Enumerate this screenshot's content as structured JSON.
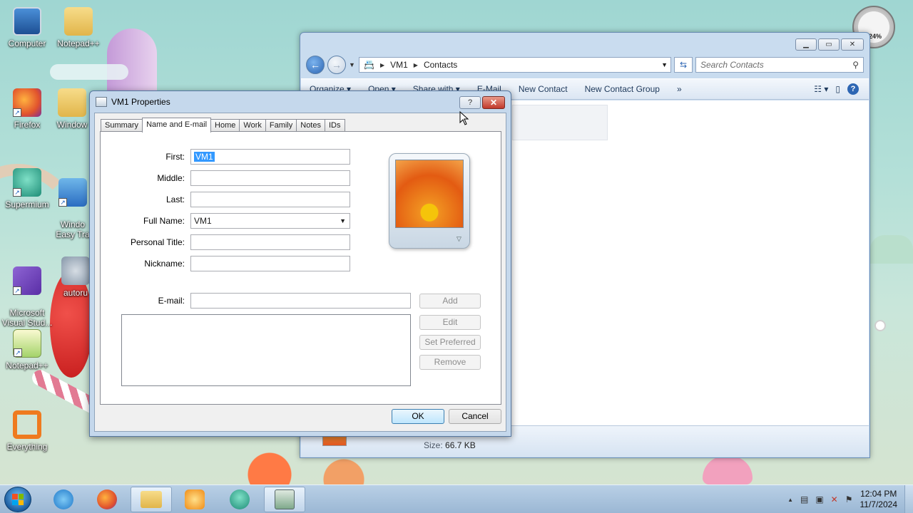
{
  "desktop": {
    "icons": [
      {
        "label": "Computer",
        "icon": "computer-icon"
      },
      {
        "label": "Notepad++",
        "icon": "folder-icon"
      },
      {
        "label": "Firefox",
        "icon": "firefox-icon"
      },
      {
        "label": "Window",
        "icon": "folder-icon"
      },
      {
        "label": "Supermium",
        "icon": "supermium-icon"
      },
      {
        "label": "Windo\nEasy Tra",
        "icon": "easy-transfer-icon"
      },
      {
        "label": "Microsoft\nVisual Stud...",
        "icon": "visual-studio-icon"
      },
      {
        "label": "autoru",
        "icon": "autorun-icon"
      },
      {
        "label": "Notepad++",
        "icon": "notepad-plus-plus-icon"
      },
      {
        "label": "Everything",
        "icon": "everything-icon"
      }
    ],
    "gauge_label": "24%"
  },
  "explorer": {
    "breadcrumb": [
      "VM1",
      "Contacts"
    ],
    "search_placeholder": "Search Contacts",
    "commands": [
      "Organize ▾",
      "Open ▾",
      "Share with ▾",
      "E-Mail",
      "New Contact",
      "New Contact Group",
      "»"
    ],
    "details": {
      "size_label": "Size:",
      "size_value": "66.7 KB"
    }
  },
  "dialog": {
    "title": "VM1 Properties",
    "help_glyph": "?",
    "close_glyph": "✕",
    "tabs": [
      "Summary",
      "Name and E-mail",
      "Home",
      "Work",
      "Family",
      "Notes",
      "IDs"
    ],
    "active_tab": "Name and E-mail",
    "fields": {
      "first_label": "First:",
      "first_value": "VM1",
      "middle_label": "Middle:",
      "middle_value": "",
      "last_label": "Last:",
      "last_value": "",
      "full_name_label": "Full Name:",
      "full_name_value": "VM1",
      "personal_title_label": "Personal Title:",
      "personal_title_value": "",
      "nickname_label": "Nickname:",
      "nickname_value": "",
      "email_label": "E-mail:",
      "email_value": ""
    },
    "buttons": {
      "add": "Add",
      "edit": "Edit",
      "set_preferred": "Set Preferred",
      "remove": "Remove",
      "ok": "OK",
      "cancel": "Cancel"
    }
  },
  "taskbar": {
    "items": [
      "internet-explorer-icon",
      "firefox-icon",
      "windows-explorer-icon",
      "media-player-icon",
      "supermium-icon",
      "contacts-icon"
    ],
    "clock_time": "12:04 PM",
    "clock_date": "11/7/2024",
    "tray_chevron": "▲"
  }
}
